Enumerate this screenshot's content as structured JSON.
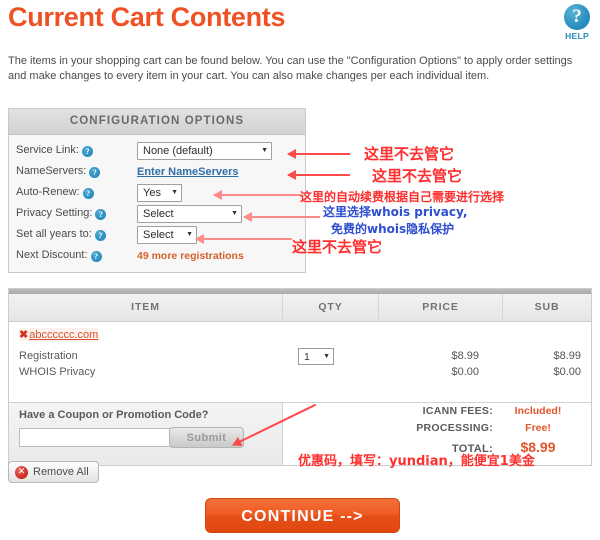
{
  "header": {
    "title": "Current Cart Contents",
    "help_icon": "question-mark-icon",
    "help_label": "HELP",
    "intro": "The items in your shopping cart can be found below. You can use the \"Configuration Options\" to apply order settings and make changes to every item in your cart. You can also make changes per each individual item."
  },
  "config": {
    "header": "CONFIGURATION OPTIONS",
    "help_glyph": "?",
    "caret": "▼",
    "rows": {
      "service_link": {
        "label": "Service Link:",
        "value": "None (default)"
      },
      "nameservers": {
        "label": "NameServers:",
        "link": "Enter NameServers"
      },
      "auto_renew": {
        "label": "Auto-Renew:",
        "value": "Yes"
      },
      "privacy_setting": {
        "label": "Privacy Setting:",
        "value": "Select"
      },
      "set_all_years": {
        "label": "Set all years to:",
        "value": "Select"
      },
      "next_discount": {
        "label": "Next Discount:",
        "value": "49 more registrations"
      }
    }
  },
  "annotations": {
    "a1": "这里不去管它",
    "a2": "这里不去管它",
    "a3": "这里的自动续费根据自己需要进行选择",
    "a4": "这里选择whois privacy,",
    "a5": "免费的whois隐私保护",
    "a6": "这里不去管它",
    "a7": "优惠码，填写：yundian，能便宜1美金"
  },
  "cart": {
    "columns": [
      "ITEM",
      "QTY",
      "PRICE",
      "SUB"
    ],
    "remove_glyph": "✖",
    "domain": "abcccccc.com",
    "caret": "▼",
    "lines": [
      {
        "name": "Registration",
        "qty": "1",
        "price": "$8.99",
        "sub": "$8.99"
      },
      {
        "name": "WHOIS Privacy",
        "price": "$0.00",
        "sub": "$0.00"
      }
    ],
    "coupon": {
      "title": "Have a Coupon or Promotion Code?",
      "value": "",
      "placeholder": "",
      "submit_label": "Submit"
    },
    "totals": [
      {
        "label": "ICANN FEES:",
        "value": "Included!"
      },
      {
        "label": "PROCESSING:",
        "value": "Free!"
      },
      {
        "label": "TOTAL:",
        "value": "$8.99"
      }
    ]
  },
  "actions": {
    "remove_all": "Remove All",
    "remove_all_glyph": "✕",
    "continue": "CONTINUE -->"
  },
  "colors": {
    "brand_orange": "#ef5124",
    "link_blue": "#2f6ea8",
    "anno_red": "#ff2f2f",
    "anno_blue": "#2f4fd0"
  }
}
